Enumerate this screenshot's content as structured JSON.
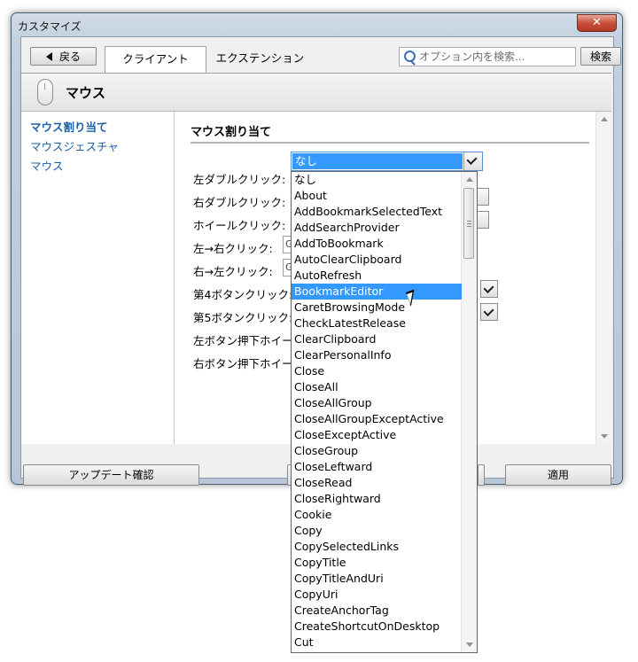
{
  "window": {
    "title": "カスタマイズ",
    "close_label": "✕"
  },
  "toolbar": {
    "back_label": "戻る",
    "tabs": [
      {
        "label": "クライアント",
        "active": true
      },
      {
        "label": "エクステンション",
        "active": false
      }
    ],
    "search_placeholder": "オプション内を検索...",
    "search_button": "検索"
  },
  "header": {
    "title": "マウス",
    "icon": "mouse-icon"
  },
  "sidebar": {
    "items": [
      {
        "label": "マウス割り当て",
        "selected": true
      },
      {
        "label": "マウスジェスチャ",
        "selected": false
      },
      {
        "label": "マウス",
        "selected": false
      }
    ]
  },
  "main": {
    "section_title": "マウス割り当て",
    "rows": [
      {
        "label": "左ダブルクリック:"
      },
      {
        "label": "右ダブルクリック:"
      },
      {
        "label": "ホイールクリック:"
      },
      {
        "label": "左→右クリック:",
        "value": "G"
      },
      {
        "label": "右→左クリック:",
        "value": "G"
      },
      {
        "label": "第4ボタンクリック:"
      },
      {
        "label": "第5ボタンクリック:"
      },
      {
        "label": "左ボタン押下ホイール"
      },
      {
        "label": "右ボタン押下ホイール"
      }
    ]
  },
  "combo": {
    "selected_value": "なし",
    "options": [
      "なし",
      "About",
      "AddBookmarkSelectedText",
      "AddSearchProvider",
      "AddToBookmark",
      "AutoClearClipboard",
      "AutoRefresh",
      "BookmarkEditor",
      "CaretBrowsingMode",
      "CheckLatestRelease",
      "ClearClipboard",
      "ClearPersonalInfo",
      "Close",
      "CloseAll",
      "CloseAllGroup",
      "CloseAllGroupExceptActive",
      "CloseExceptActive",
      "CloseGroup",
      "CloseLeftward",
      "CloseRead",
      "CloseRightward",
      "Cookie",
      "Copy",
      "CopySelectedLinks",
      "CopyTitle",
      "CopyTitleAndUri",
      "CopyUri",
      "CreateAnchorTag",
      "CreateShortcutOnDesktop",
      "Cut"
    ],
    "highlighted": "BookmarkEditor"
  },
  "footer": {
    "update_button": "アップデート確認",
    "apply_button": "適用"
  }
}
